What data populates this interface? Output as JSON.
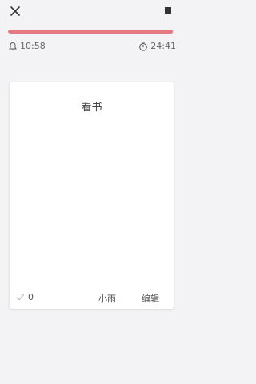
{
  "header": {
    "alarm_time": "10:58",
    "remaining_time": "24:41",
    "progress": 0.99,
    "accent_color": "#e57982"
  },
  "card": {
    "title": "看书",
    "done_count": "0",
    "owner": "小雨",
    "edit_label": "编辑"
  },
  "icons": {
    "close": "close-icon",
    "stop": "stop-icon",
    "alarm": "bell-icon",
    "timer": "stopwatch-icon",
    "check": "check-icon"
  }
}
